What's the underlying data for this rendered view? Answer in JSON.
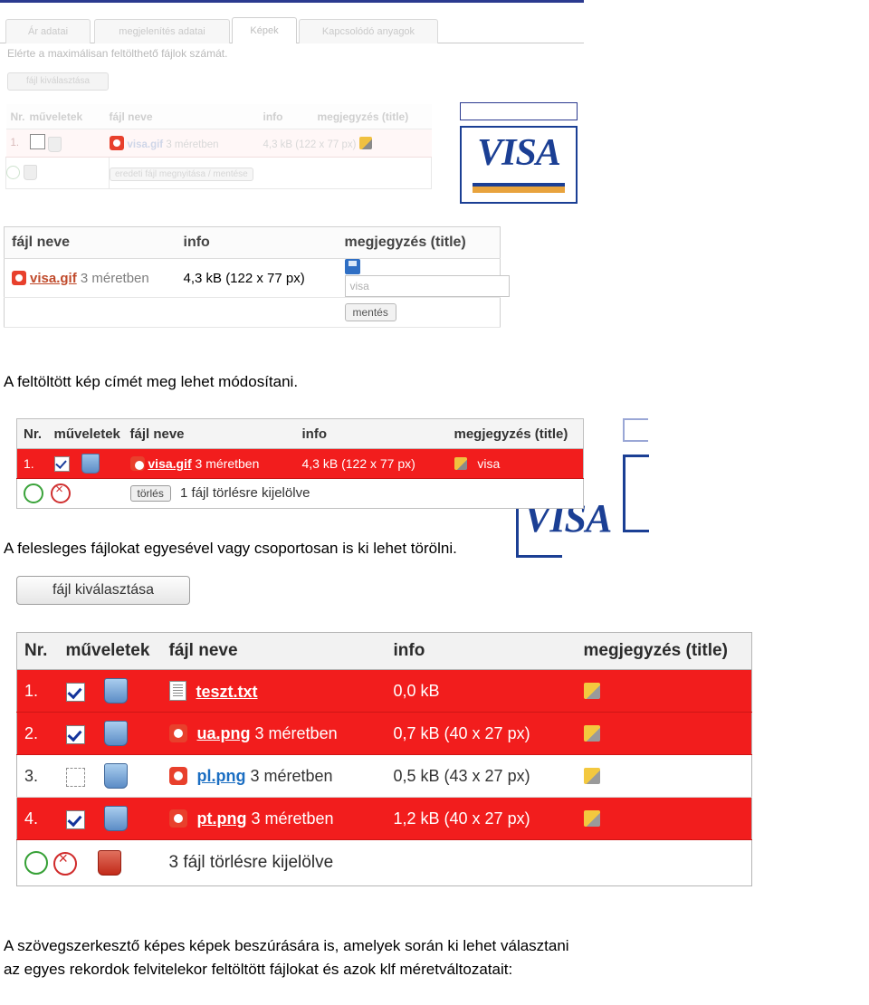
{
  "document": {
    "language": "hu",
    "captions": {
      "caption1": "A feltöltött kép címét meg lehet módosítani.",
      "caption2": "A felesleges fájlokat egyesével vagy csoportosan is ki lehet törölni.",
      "caption3_line1": "A szövegszerkesztő képes képek beszúrására is, amelyek során ki lehet választani",
      "caption3_line2": "az egyes rekordok felvitelekor feltöltött fájlokat és azok klf méretváltozatait:"
    }
  },
  "screenshot1": {
    "tabs": [
      {
        "label": "Ár adatai",
        "active": false
      },
      {
        "label": "megjelenítés adatai",
        "active": false
      },
      {
        "label": "Képek",
        "active": true
      },
      {
        "label": "Kapcsolódó anyagok",
        "active": false
      }
    ],
    "message": "Elérte a maximálisan feltölthető fájlok számát.",
    "file_button": "fájl kiválasztása",
    "table": {
      "headers": [
        "Nr.",
        "műveletek",
        "fájl neve",
        "info",
        "megjegyzés (title)"
      ],
      "rows": [
        {
          "nr": "1.",
          "filename": "visa.gif",
          "sizes": "3 méretben",
          "info": "4,3 kB (122 x 77 px)"
        }
      ],
      "footer_link": "eredeti fájl megnyitása / mentése"
    },
    "visa_logo": "VISA"
  },
  "screenshot2": {
    "headers": [
      "fájl neve",
      "info",
      "megjegyzés (title)"
    ],
    "row": {
      "filename": "visa.gif",
      "sizes": "3 méretben",
      "info": "4,3 kB (122 x 77 px)",
      "title_value": "visa"
    },
    "save_button": "mentés",
    "visa_logo": "VISA"
  },
  "screenshot3": {
    "headers": [
      "Nr.",
      "műveletek",
      "fájl neve",
      "info",
      "megjegyzés (title)"
    ],
    "row": {
      "nr": "1.",
      "checked": true,
      "filename": "visa.gif",
      "sizes": "3 méretben",
      "info": "4,3 kB (122 x 77 px)",
      "title_value": "visa"
    },
    "delete_button": "törlés",
    "status": "1 fájl törlésre kijelölve"
  },
  "file_select_button": "fájl kiválasztása",
  "screenshot4": {
    "headers": [
      "Nr.",
      "műveletek",
      "fájl neve",
      "info",
      "megjegyzés (title)"
    ],
    "rows": [
      {
        "nr": "1.",
        "checked": true,
        "selected": true,
        "icon": "text-file-icon",
        "filename": "teszt.txt",
        "sizes": "",
        "info": "0,0 kB"
      },
      {
        "nr": "2.",
        "checked": true,
        "selected": true,
        "icon": "image-file-icon",
        "filename": "ua.png",
        "sizes": "3 méretben",
        "info": "0,7 kB (40 x 27 px)"
      },
      {
        "nr": "3.",
        "checked": false,
        "selected": false,
        "icon": "image-file-icon",
        "filename": "pl.png",
        "sizes": "3 méretben",
        "info": "0,5 kB (43 x 27 px)"
      },
      {
        "nr": "4.",
        "checked": true,
        "selected": true,
        "icon": "image-file-icon",
        "filename": "pt.png",
        "sizes": "3 méretben",
        "info": "1,2 kB (40 x 27 px)"
      }
    ],
    "status": "3 fájl törlésre kijelölve"
  },
  "colors": {
    "selected_row": "#f21d1d",
    "visa_blue": "#1b3f94",
    "visa_gold": "#e8a33d",
    "link_blue": "#1b6ec2"
  }
}
